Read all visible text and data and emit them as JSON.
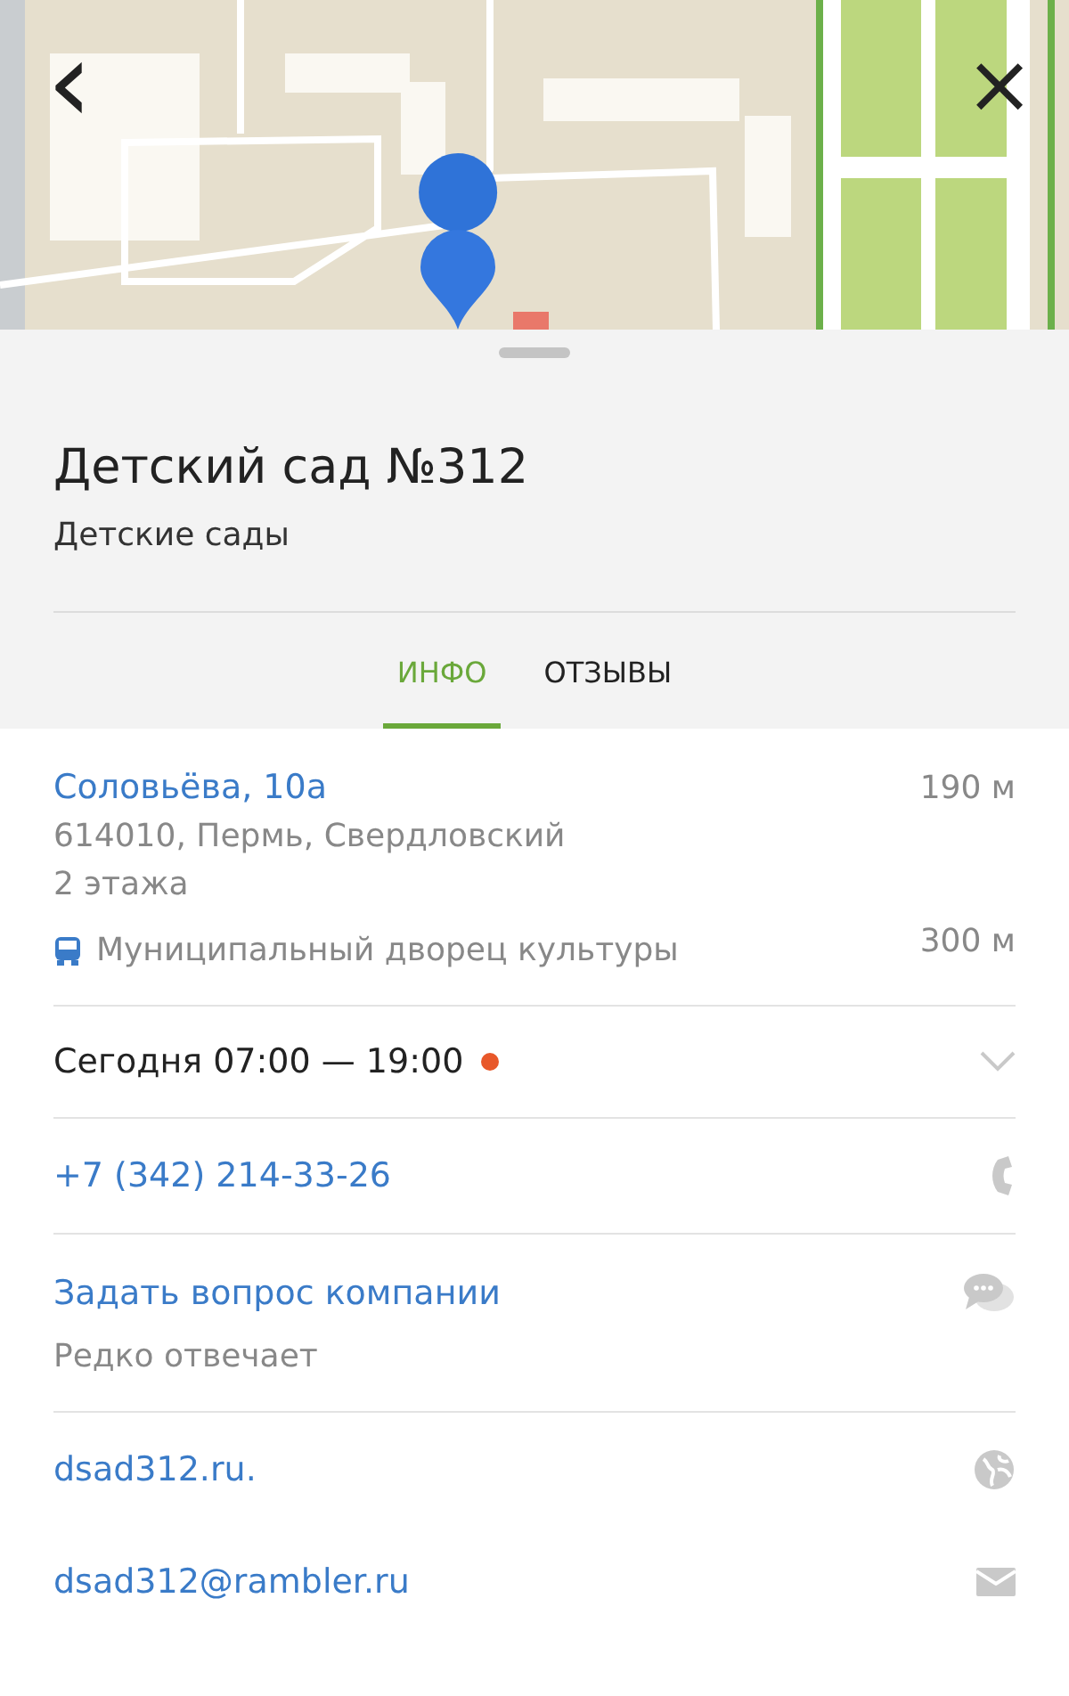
{
  "nav": {
    "back": "‹",
    "close": "×"
  },
  "place": {
    "title": "Детский сад №312",
    "category": "Детские сады"
  },
  "tabs": [
    {
      "label": "ИНФО",
      "selected": true
    },
    {
      "label": "ОТЗЫВЫ",
      "selected": false
    }
  ],
  "address": {
    "street": "Соловьёва, 10а",
    "distance": "190 м",
    "city": "614010, Пермь, Свердловский",
    "floors": "2 этажа",
    "stop": "Муниципальный дворец культуры",
    "stop_distance": "300 м"
  },
  "hours": {
    "text": "Сегодня 07:00 — 19:00",
    "color": "#e8582a",
    "expanded": false
  },
  "contacts": [
    {
      "kind": "phone",
      "text": "+7 (342) 214-33-26"
    },
    {
      "kind": "question",
      "text": "Задать вопрос компании",
      "note": "Редко отвечает"
    },
    {
      "kind": "site",
      "text": "dsad312.ru."
    },
    {
      "kind": "email",
      "text": "dsad312@rambler.ru"
    }
  ]
}
